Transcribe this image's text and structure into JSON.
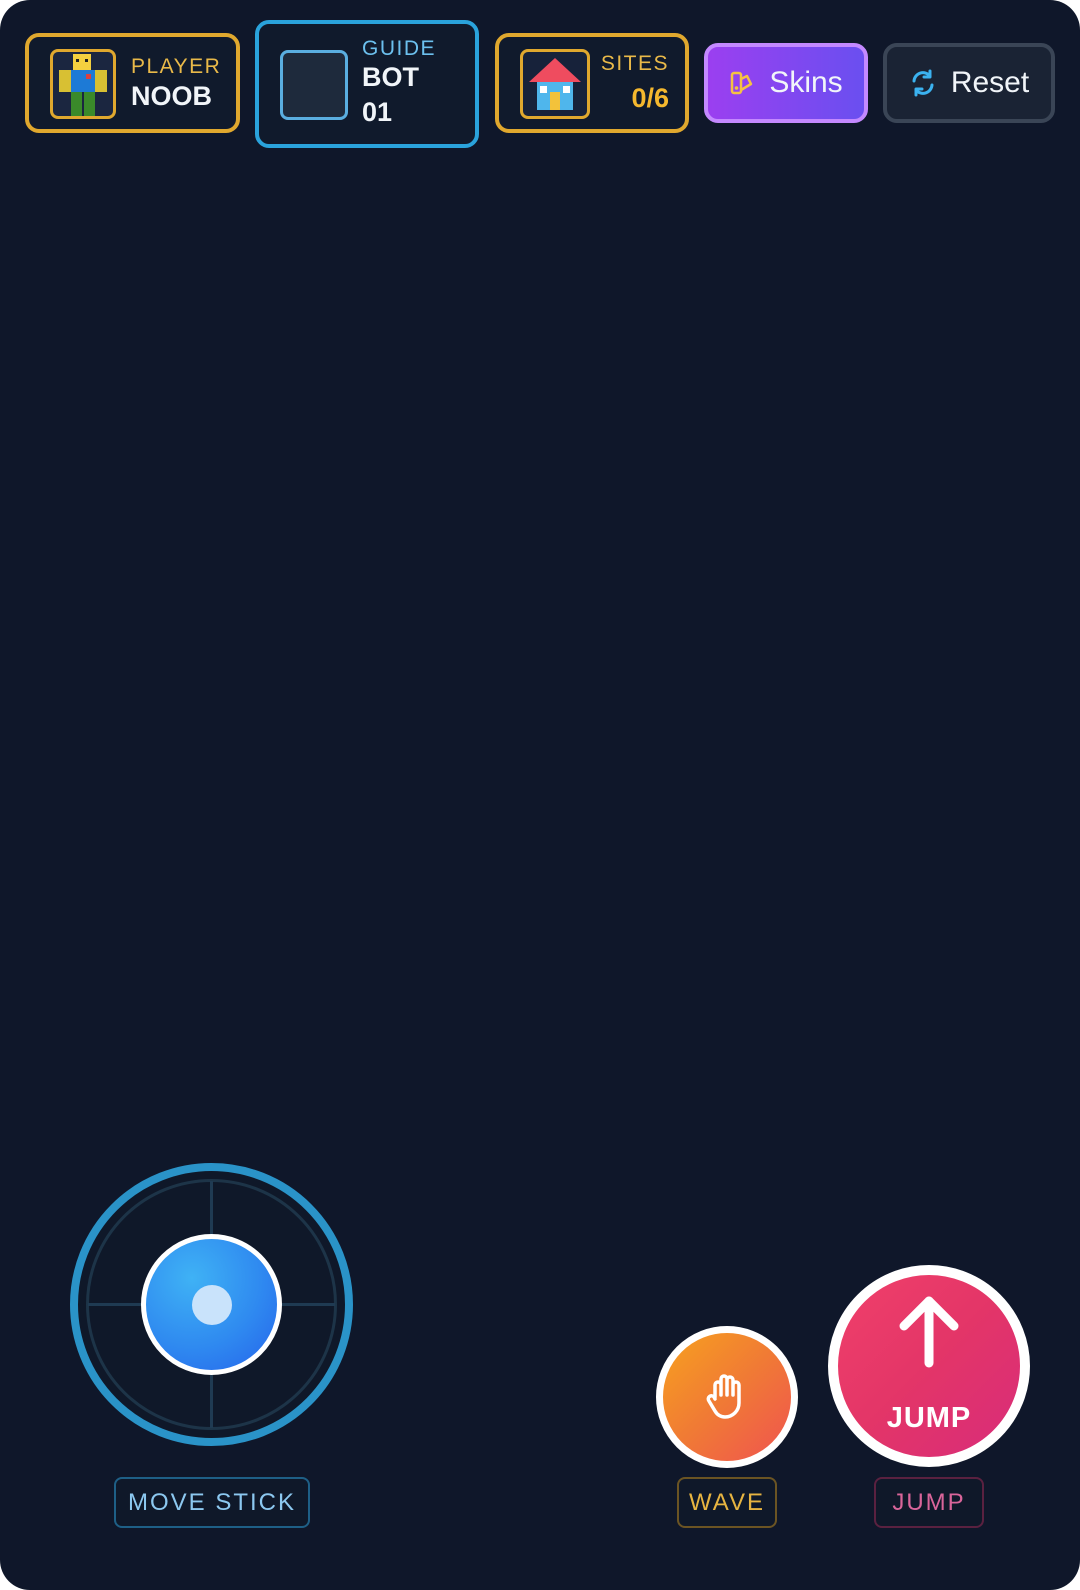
{
  "hud": {
    "player": {
      "label": "PLAYER",
      "name": "NOOB",
      "avatar_icon": "noob-avatar-icon"
    },
    "guide": {
      "label": "GUIDE",
      "name_line1": "BOT",
      "name_line2": "01"
    },
    "sites": {
      "label": "SITES",
      "value": "0/6",
      "icon": "house-icon"
    },
    "skins_button": {
      "label": "Skins",
      "icon": "palette-icon"
    },
    "reset_button": {
      "label": "Reset",
      "icon": "refresh-icon"
    }
  },
  "controls": {
    "move_stick_label": "MOVE STICK",
    "wave_label": "WAVE",
    "jump_button_text": "JUMP",
    "jump_label": "JUMP"
  },
  "colors": {
    "background": "#0f172a",
    "gold": "#e0a82e",
    "blue": "#2aa3dc",
    "skins_purple": "#9b3ff0",
    "jump_pink": "#e33568",
    "wave_orange": "#f07a35"
  }
}
